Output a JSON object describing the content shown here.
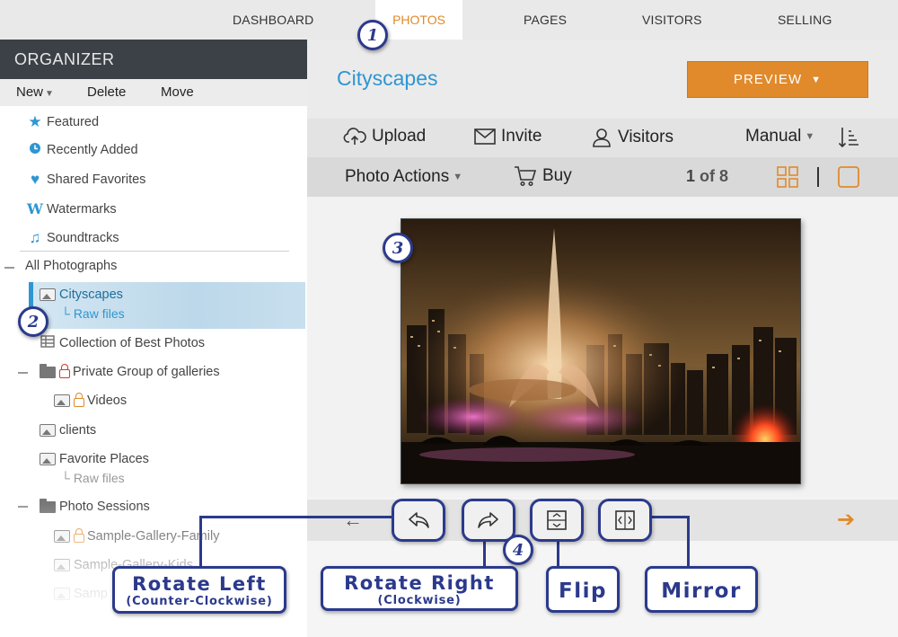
{
  "topnav": {
    "items": [
      "DASHBOARD",
      "PHOTOS",
      "PAGES",
      "VISITORS",
      "SELLING"
    ],
    "active": "PHOTOS"
  },
  "sidebar": {
    "title": "ORGANIZER",
    "toolbar": {
      "new": "New",
      "delete": "Delete",
      "move": "Move"
    },
    "quick_links": [
      {
        "label": "Featured",
        "icon": "star-icon"
      },
      {
        "label": "Recently Added",
        "icon": "clock-icon"
      },
      {
        "label": "Shared Favorites",
        "icon": "heart-icon"
      },
      {
        "label": "Watermarks",
        "icon": "watermark-icon"
      },
      {
        "label": "Soundtracks",
        "icon": "music-note-icon"
      }
    ],
    "root": "All Photographs",
    "tree": {
      "cityscapes": "Cityscapes",
      "cityscapes_sub": "Raw files",
      "collection": "Collection of Best Photos",
      "private_group": "Private Group of galleries",
      "videos": "Videos",
      "clients": "clients",
      "favorite_places": "Favorite Places",
      "favorite_places_sub": "Raw files",
      "photo_sessions": "Photo Sessions",
      "family": "Sample-Gallery-Family",
      "kids": "Sample-Gallery-Kids",
      "more": "Samp"
    }
  },
  "main": {
    "gallery_title": "Cityscapes",
    "preview_label": "PREVIEW",
    "toolbar1": {
      "upload": "Upload",
      "invite": "Invite",
      "visitors": "Visitors",
      "sort": "Manual"
    },
    "toolbar2": {
      "photo_actions": "Photo Actions",
      "buy": "Buy",
      "page_current": "1",
      "page_of": "of 8"
    }
  },
  "callouts": [
    "1",
    "2",
    "3",
    "4"
  ],
  "actions": {
    "rotate_left": {
      "title": "Rotate Left",
      "subtitle": "(Counter-Clockwise)"
    },
    "rotate_right": {
      "title": "Rotate Right",
      "subtitle": "(Clockwise)"
    },
    "flip": {
      "title": "Flip"
    },
    "mirror": {
      "title": "Mirror"
    }
  },
  "colors": {
    "accent_blue": "#2e96d3",
    "accent_orange": "#e08a2c",
    "callout_navy": "#2b3a8c",
    "sidebar_header": "#3c4147"
  }
}
